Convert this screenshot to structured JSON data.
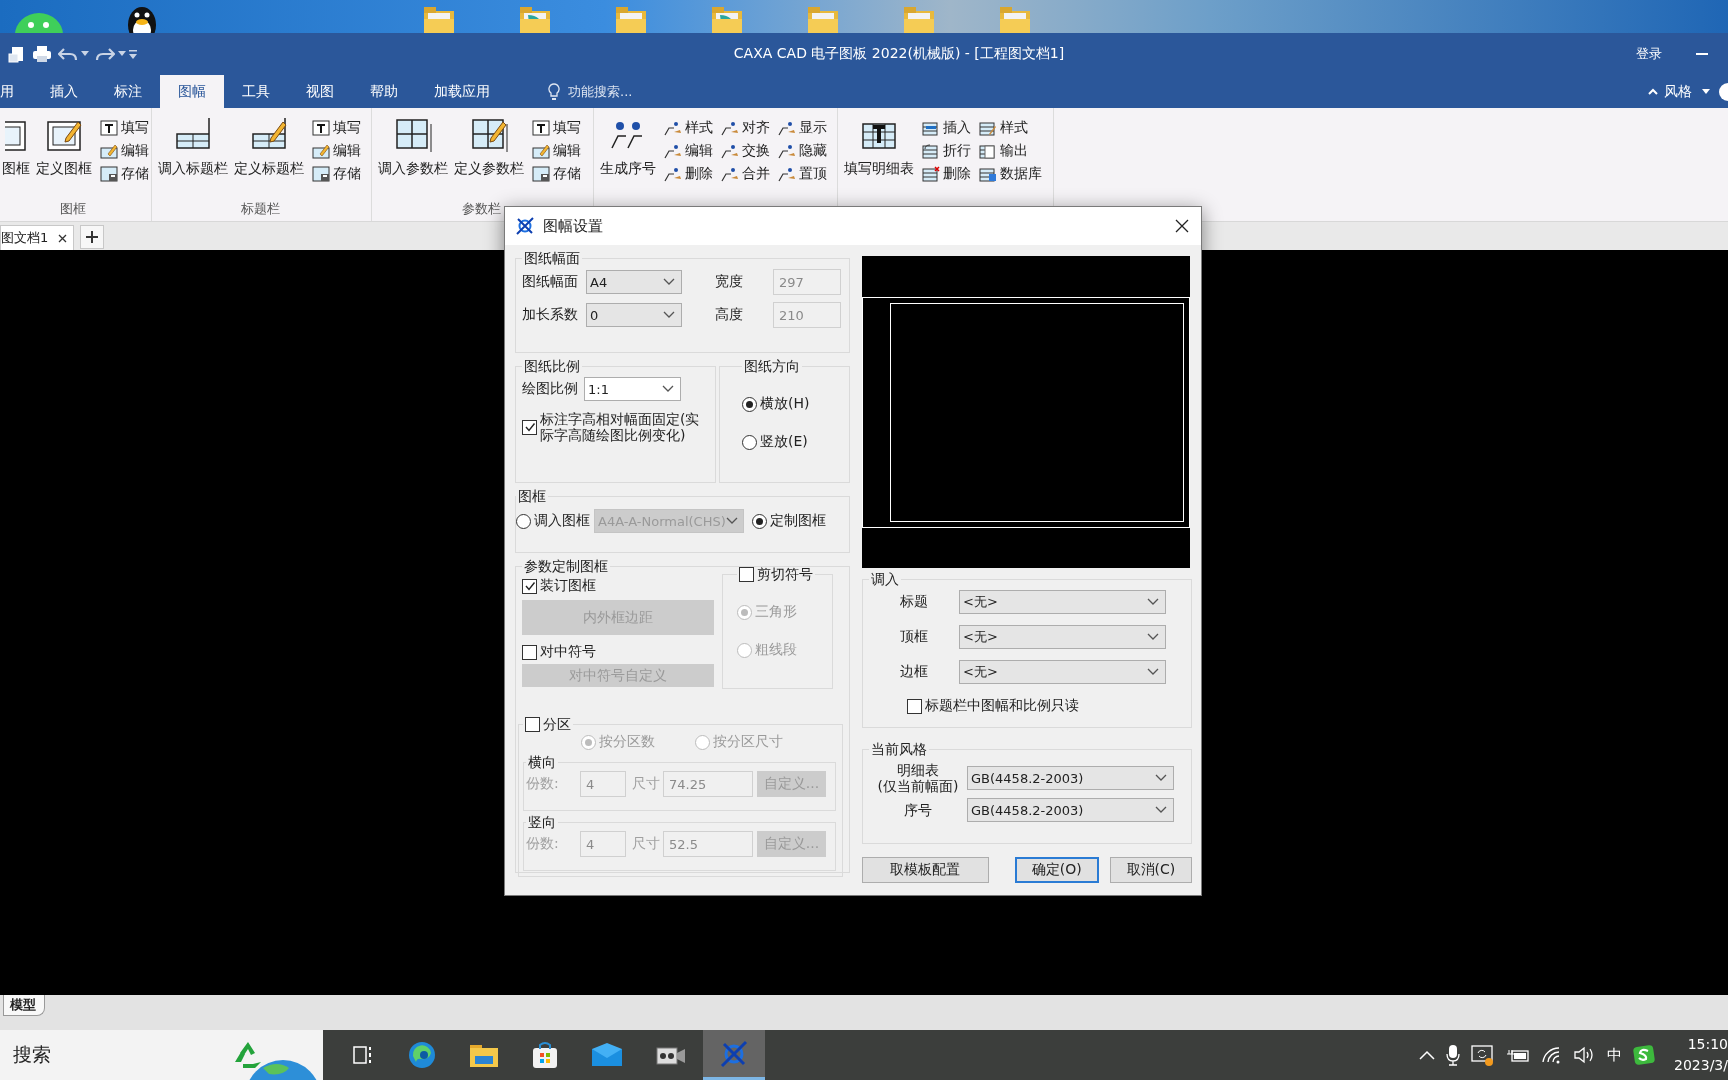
{
  "app": {
    "title": "CAXA CAD 电子图板 2022(机械版) - [工程图文档1]",
    "login": "登录"
  },
  "ribbon": {
    "tabs": [
      {
        "label": "用",
        "selected": false
      },
      {
        "label": "插入",
        "selected": false
      },
      {
        "label": "标注",
        "selected": false
      },
      {
        "label": "图幅",
        "selected": true
      },
      {
        "label": "工具",
        "selected": false
      },
      {
        "label": "视图",
        "selected": false
      },
      {
        "label": "帮助",
        "selected": false
      },
      {
        "label": "加载应用",
        "selected": false
      }
    ],
    "search": {
      "placeholder": "功能搜索..."
    },
    "style_menu": "风格",
    "groups": [
      {
        "label": "图框",
        "items": [
          {
            "kind": "large",
            "label": "图框"
          },
          {
            "kind": "large",
            "label": "定义图框"
          },
          {
            "kind": "small",
            "label": "填写"
          },
          {
            "kind": "small",
            "label": "编辑"
          },
          {
            "kind": "small",
            "label": "存储"
          }
        ]
      },
      {
        "label": "标题栏",
        "items": [
          {
            "kind": "large",
            "label": "调入标题栏"
          },
          {
            "kind": "large",
            "label": "定义标题栏"
          },
          {
            "kind": "small",
            "label": "填写"
          },
          {
            "kind": "small",
            "label": "编辑"
          },
          {
            "kind": "small",
            "label": "存储"
          }
        ]
      },
      {
        "label": "参数栏",
        "items": [
          {
            "kind": "large",
            "label": "调入参数栏"
          },
          {
            "kind": "large",
            "label": "定义参数栏"
          },
          {
            "kind": "small",
            "label": "填写"
          },
          {
            "kind": "small",
            "label": "编辑"
          },
          {
            "kind": "small",
            "label": "存储"
          }
        ]
      },
      {
        "items": [
          {
            "kind": "large",
            "label": "生成序号"
          },
          {
            "kind": "small",
            "label": "样式"
          },
          {
            "kind": "small",
            "label": "编辑"
          },
          {
            "kind": "small",
            "label": "删除"
          },
          {
            "kind": "small",
            "label": "对齐"
          },
          {
            "kind": "small",
            "label": "交换"
          },
          {
            "kind": "small",
            "label": "合并"
          },
          {
            "kind": "small",
            "label": "显示"
          },
          {
            "kind": "small",
            "label": "隐藏"
          },
          {
            "kind": "small",
            "label": "置顶"
          }
        ]
      },
      {
        "items": [
          {
            "kind": "large",
            "label": "填写明细表"
          },
          {
            "kind": "small",
            "label": "插入"
          },
          {
            "kind": "small",
            "label": "折行"
          },
          {
            "kind": "small",
            "label": "删除"
          },
          {
            "kind": "small",
            "label": "样式"
          },
          {
            "kind": "small",
            "label": "输出"
          },
          {
            "kind": "small",
            "label": "数据库"
          }
        ]
      }
    ]
  },
  "document_tabs": [
    {
      "label": "图文档1",
      "selected": true
    }
  ],
  "model_tabs": [
    {
      "label": "模型",
      "selected": true
    }
  ],
  "dialog": {
    "title": "图幅设置",
    "paper": {
      "label": "图纸幅面",
      "size": {
        "label": "图纸幅面",
        "value": "A4"
      },
      "factor": {
        "label": "加长系数",
        "value": "0"
      },
      "width": {
        "label": "宽度",
        "value": "297",
        "disabled": true
      },
      "height": {
        "label": "高度",
        "value": "210",
        "disabled": true
      }
    },
    "scale": {
      "label": "图纸比例",
      "ratio": {
        "label": "绘图比例",
        "value": "1:1"
      },
      "fixed_text": {
        "label": "标注字高相对幅面固定(实际字高随绘图比例变化)",
        "checked": true
      }
    },
    "orientation": {
      "label": "图纸方向",
      "options": [
        {
          "label": "横放(H)",
          "selected": true,
          "disabled": false
        },
        {
          "label": "竖放(E)",
          "selected": false,
          "disabled": false
        }
      ]
    },
    "frame": {
      "label": "图框",
      "options": [
        {
          "label": "调入图框",
          "selected": false,
          "disabled": false
        },
        {
          "label": "定制图框",
          "selected": true,
          "disabled": false
        }
      ],
      "template": {
        "value": "A4A-A-Normal(CHS)",
        "disabled": true
      }
    },
    "custom_frame": {
      "label": "参数定制图框",
      "binding": {
        "label": "装订图框",
        "checked": true
      },
      "margin_button": {
        "label": "内外框边距",
        "disabled": true
      },
      "centering": {
        "label": "对中符号",
        "checked": false
      },
      "centering_button": {
        "label": "对中符号自定义",
        "disabled": true
      },
      "cut_mark": {
        "label": "剪切符号",
        "checked": false,
        "options": [
          {
            "label": "三角形",
            "selected": true,
            "disabled": true
          },
          {
            "label": "粗线段",
            "selected": false,
            "disabled": true
          }
        ]
      },
      "zoning": {
        "label": "分区",
        "checked": false,
        "modes": [
          {
            "label": "按分区数",
            "selected": true,
            "disabled": true
          },
          {
            "label": "按分区尺寸",
            "selected": false,
            "disabled": true
          }
        ],
        "directions": [
          {
            "label": "横向",
            "count_label": "份数:",
            "count": "4",
            "size_label": "尺寸",
            "size": "74.25",
            "button": "自定义...",
            "disabled": true
          },
          {
            "label": "竖向",
            "count_label": "份数:",
            "count": "4",
            "size_label": "尺寸",
            "size": "52.5",
            "button": "自定义...",
            "disabled": true
          }
        ]
      }
    },
    "load": {
      "label": "调入",
      "rows": [
        {
          "label": "标题",
          "value": "<无>"
        },
        {
          "label": "顶框",
          "value": "<无>"
        },
        {
          "label": "边框",
          "value": "<无>"
        }
      ],
      "readonly": {
        "label": "标题栏中图幅和比例只读",
        "checked": false
      }
    },
    "style": {
      "label": "当前风格",
      "rows": [
        {
          "label": "明细表",
          "note": "(仅当前幅面)",
          "value": "GB(4458.2-2003)"
        },
        {
          "label": "序号",
          "value": "GB(4458.2-2003)"
        }
      ]
    },
    "buttons": [
      {
        "label": "取模板配置",
        "default": false
      },
      {
        "label": "确定(O)",
        "default": true
      },
      {
        "label": "取消(C)",
        "default": false
      }
    ]
  },
  "taskbar": {
    "search": "搜索",
    "ime": "中",
    "time": "15:10",
    "date": "2023/3/"
  }
}
